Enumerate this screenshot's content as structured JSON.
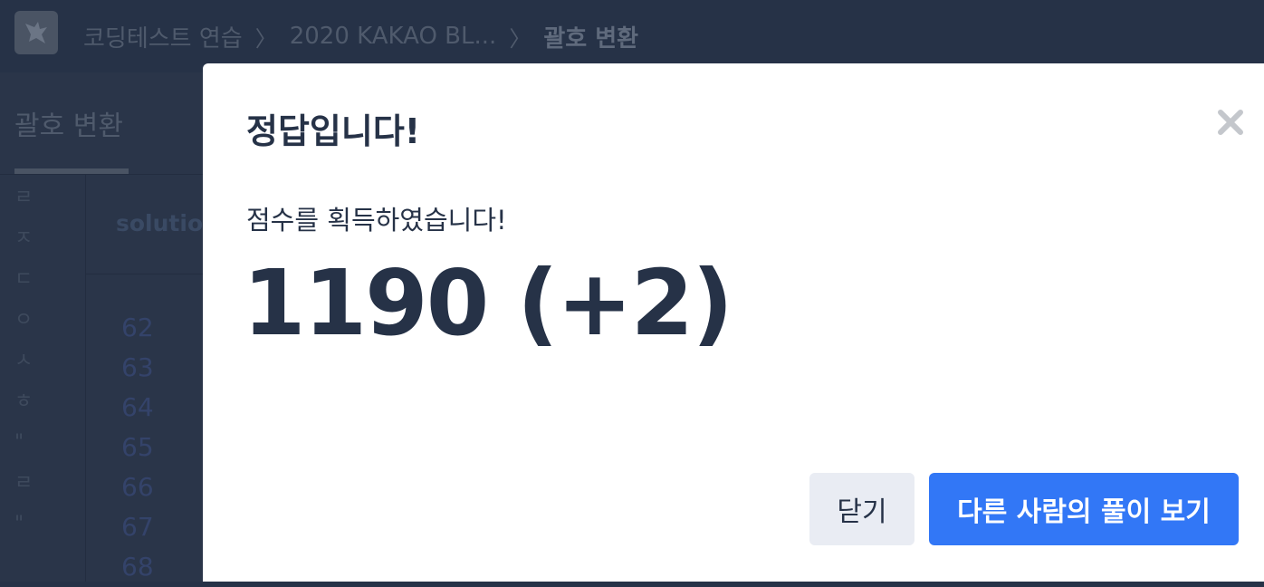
{
  "header": {
    "breadcrumbs": [
      "코딩테스트 연습",
      "2020 KAKAO BL..."
    ],
    "current": "괄호 변환"
  },
  "sidebar": {
    "tab_title": "괄호 변환",
    "vertical_chars": [
      "ㄹ",
      "ㅈ",
      "ㄷ",
      "ㅇ",
      "ㅅ",
      "ㅎ",
      "\"",
      "ㄹ",
      "\""
    ]
  },
  "editor": {
    "file_label": "solution",
    "line_numbers": [
      "62",
      "63",
      "64",
      "65",
      "66",
      "67",
      "68"
    ]
  },
  "modal": {
    "title": "정답입니다!",
    "message": "점수를 획득하였습니다!",
    "score": "1190 (+2)",
    "close_label": "닫기",
    "view_others_label": "다른 사람의 풀이 보기"
  },
  "colors": {
    "background": "#263247",
    "modal_bg": "#ffffff",
    "text_dark": "#263247",
    "primary_button": "#3277f6",
    "secondary_button": "#e9ecf3"
  }
}
